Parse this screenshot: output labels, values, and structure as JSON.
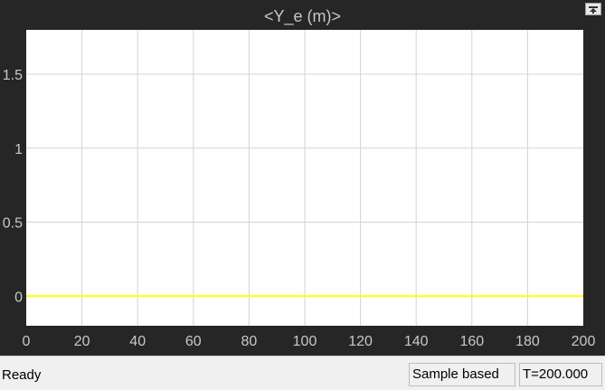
{
  "window": {
    "plot_title": "<Y_e (m)>",
    "undock_icon": "undock-icon"
  },
  "status_bar": {
    "status": "Ready",
    "mode": "Sample based",
    "time": "T=200.000"
  },
  "colors": {
    "figure_background": "#262626",
    "axes_background": "#ffffff",
    "grid": "#d4d4d4",
    "tick_label": "#c8c8c8",
    "signal": "#ffff00"
  },
  "chart_data": {
    "type": "line",
    "title": "<Y_e (m)>",
    "xlabel": "",
    "ylabel": "",
    "xlim": [
      0,
      200
    ],
    "ylim": [
      -0.2,
      1.8
    ],
    "grid": true,
    "x_ticks": [
      "0",
      "20",
      "40",
      "60",
      "80",
      "100",
      "120",
      "140",
      "160",
      "180",
      "200"
    ],
    "y_ticks": [
      "0",
      "0.5",
      "1",
      "1.5"
    ],
    "x_tick_values": [
      0,
      20,
      40,
      60,
      80,
      100,
      120,
      140,
      160,
      180,
      200
    ],
    "y_tick_values": [
      0,
      0.5,
      1,
      1.5
    ],
    "series": [
      {
        "x": [
          0,
          200
        ],
        "values": [
          0,
          0
        ]
      }
    ]
  }
}
